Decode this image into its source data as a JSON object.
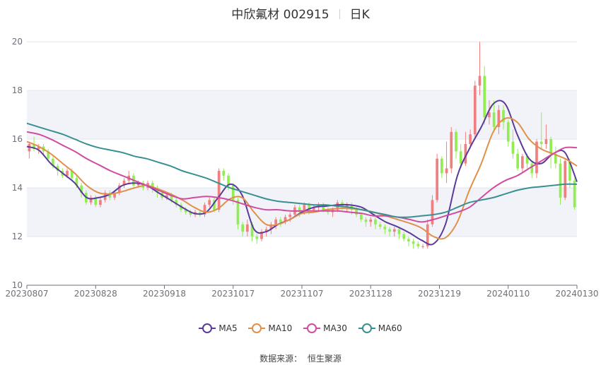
{
  "title": {
    "name": "中欣氟材 002915",
    "period": "日K"
  },
  "source": {
    "label": "数据来源：",
    "value": "恒生聚源"
  },
  "colors": {
    "up": "#f08080",
    "down": "#90ee50",
    "MA5": "#5a3a9a",
    "MA10": "#e0904a",
    "MA30": "#d04ca0",
    "MA60": "#3a9090",
    "band": "#f2f3f9",
    "grid": "#e3e5ee"
  },
  "chart_data": {
    "type": "candlestick",
    "x_range": [
      "20230807",
      "20240130"
    ],
    "xticks": [
      "20230807",
      "20230828",
      "20230918",
      "20231017",
      "20231107",
      "20231128",
      "20231219",
      "20240110",
      "20240130"
    ],
    "yticks": [
      10,
      12,
      14,
      16,
      18,
      20
    ],
    "ylim": [
      10,
      20.5
    ],
    "series": [
      {
        "name": "MA5",
        "values": [
          15.7,
          15.55,
          15.0,
          14.6,
          14.2,
          13.6,
          13.6,
          13.75,
          14.1,
          14.2,
          14.1,
          13.8,
          13.5,
          13.2,
          12.95,
          13.0,
          13.6,
          14.15,
          13.7,
          12.3,
          12.2,
          12.5,
          12.7,
          13.0,
          13.2,
          13.25,
          13.3,
          13.3,
          13.2,
          12.9,
          12.6,
          12.4,
          12.15,
          11.85,
          11.7,
          12.5,
          14.5,
          15.6,
          16.5,
          17.45,
          17.45,
          16.2,
          15.2,
          15.0,
          15.4,
          15.45,
          14.25
        ]
      },
      {
        "name": "MA10",
        "values": [
          15.9,
          15.7,
          15.4,
          15.0,
          14.6,
          14.1,
          13.8,
          13.75,
          13.85,
          14.0,
          14.1,
          13.95,
          13.75,
          13.5,
          13.2,
          13.0,
          13.15,
          13.55,
          13.6,
          13.0,
          12.5,
          12.5,
          12.7,
          12.95,
          13.0,
          13.1,
          13.15,
          13.15,
          13.1,
          13.0,
          12.85,
          12.7,
          12.55,
          12.35,
          12.0,
          11.95,
          12.6,
          13.9,
          15.0,
          16.3,
          16.85,
          16.7,
          16.0,
          15.6,
          15.4,
          15.2,
          14.9
        ]
      },
      {
        "name": "MA30",
        "values": [
          16.3,
          16.2,
          16.0,
          15.75,
          15.5,
          15.2,
          14.95,
          14.7,
          14.5,
          14.3,
          14.1,
          13.9,
          13.7,
          13.55,
          13.6,
          13.65,
          13.6,
          13.5,
          13.35,
          13.2,
          13.1,
          13.1,
          13.05,
          13.05,
          13.05,
          13.05,
          13.05,
          13.0,
          12.95,
          12.85,
          12.85,
          12.8,
          12.7,
          12.6,
          12.7,
          12.85,
          13.0,
          13.2,
          13.6,
          14.0,
          14.3,
          14.5,
          14.8,
          15.1,
          15.4,
          15.65,
          15.65
        ]
      },
      {
        "name": "MA60",
        "values": [
          16.65,
          16.5,
          16.35,
          16.2,
          16.0,
          15.8,
          15.65,
          15.55,
          15.45,
          15.3,
          15.2,
          15.05,
          14.9,
          14.7,
          14.55,
          14.4,
          14.2,
          14.0,
          13.85,
          13.7,
          13.55,
          13.45,
          13.4,
          13.35,
          13.3,
          13.3,
          13.25,
          13.2,
          13.1,
          13.0,
          12.9,
          12.8,
          12.8,
          12.85,
          12.9,
          13.0,
          13.2,
          13.4,
          13.5,
          13.6,
          13.75,
          13.9,
          14.0,
          14.05,
          14.1,
          14.15,
          14.15
        ]
      }
    ],
    "candles": [
      [
        15.5,
        15.8,
        15.9,
        15.2
      ],
      [
        15.8,
        15.6,
        16.1,
        15.5
      ],
      [
        15.6,
        15.7,
        15.8,
        15.4
      ],
      [
        15.7,
        15.5,
        15.8,
        15.3
      ],
      [
        15.5,
        15.2,
        15.6,
        15.1
      ],
      [
        15.2,
        14.9,
        15.3,
        14.8
      ],
      [
        14.9,
        14.7,
        15.0,
        14.5
      ],
      [
        14.7,
        14.5,
        14.8,
        14.4
      ],
      [
        14.5,
        14.7,
        14.8,
        14.4
      ],
      [
        14.7,
        14.4,
        14.8,
        14.3
      ],
      [
        14.4,
        14.1,
        14.5,
        14.0
      ],
      [
        14.1,
        13.8,
        14.2,
        13.6
      ],
      [
        13.8,
        13.4,
        13.9,
        13.3
      ],
      [
        13.4,
        13.6,
        13.7,
        13.3
      ],
      [
        13.6,
        13.3,
        13.7,
        13.2
      ],
      [
        13.3,
        13.5,
        13.6,
        13.2
      ],
      [
        13.5,
        13.8,
        13.9,
        13.4
      ],
      [
        13.8,
        13.6,
        13.9,
        13.5
      ],
      [
        13.6,
        13.8,
        13.9,
        13.5
      ],
      [
        13.8,
        14.1,
        14.2,
        13.7
      ],
      [
        14.1,
        14.3,
        14.4,
        14.0
      ],
      [
        14.3,
        14.5,
        14.7,
        14.2
      ],
      [
        14.5,
        14.1,
        14.6,
        14.0
      ],
      [
        14.1,
        14.2,
        14.3,
        14.0
      ],
      [
        14.2,
        14.0,
        14.3,
        13.9
      ],
      [
        14.0,
        14.2,
        14.3,
        13.9
      ],
      [
        14.2,
        14.0,
        14.3,
        13.8
      ],
      [
        14.0,
        13.8,
        14.1,
        13.6
      ],
      [
        13.8,
        13.6,
        13.9,
        13.5
      ],
      [
        13.6,
        13.7,
        13.8,
        13.5
      ],
      [
        13.7,
        13.5,
        13.8,
        13.4
      ],
      [
        13.5,
        13.3,
        13.6,
        13.2
      ],
      [
        13.3,
        13.1,
        13.4,
        13.0
      ],
      [
        13.1,
        13.0,
        13.2,
        12.9
      ],
      [
        13.0,
        12.9,
        13.1,
        12.8
      ],
      [
        12.9,
        13.0,
        13.1,
        12.8
      ],
      [
        13.0,
        12.9,
        13.1,
        12.8
      ],
      [
        12.9,
        13.3,
        13.4,
        12.8
      ],
      [
        13.3,
        13.5,
        13.6,
        13.2
      ],
      [
        13.5,
        13.1,
        13.6,
        13.0
      ],
      [
        13.1,
        14.7,
        14.8,
        13.0
      ],
      [
        14.7,
        14.5,
        14.8,
        14.3
      ],
      [
        14.5,
        14.1,
        14.6,
        13.9
      ],
      [
        14.1,
        13.5,
        14.2,
        13.3
      ],
      [
        13.5,
        12.5,
        13.6,
        12.3
      ],
      [
        12.5,
        12.2,
        12.6,
        12.0
      ],
      [
        12.2,
        12.5,
        12.7,
        12.0
      ],
      [
        12.5,
        12.0,
        12.6,
        11.8
      ],
      [
        12.0,
        11.9,
        12.1,
        11.7
      ],
      [
        11.9,
        12.2,
        12.3,
        11.8
      ],
      [
        12.2,
        12.3,
        12.4,
        12.0
      ],
      [
        12.3,
        12.5,
        12.6,
        12.1
      ],
      [
        12.5,
        12.7,
        12.8,
        12.3
      ],
      [
        12.7,
        12.6,
        12.8,
        12.4
      ],
      [
        12.6,
        12.8,
        12.9,
        12.5
      ],
      [
        12.8,
        12.9,
        13.0,
        12.6
      ],
      [
        12.9,
        13.2,
        13.3,
        12.8
      ],
      [
        13.2,
        13.0,
        13.3,
        12.8
      ],
      [
        13.0,
        13.3,
        13.4,
        12.9
      ],
      [
        13.3,
        13.1,
        13.4,
        12.9
      ],
      [
        13.1,
        13.2,
        13.3,
        13.0
      ],
      [
        13.2,
        13.3,
        13.4,
        13.0
      ],
      [
        13.3,
        13.1,
        13.4,
        13.0
      ],
      [
        13.1,
        13.0,
        13.2,
        12.9
      ],
      [
        13.0,
        13.1,
        13.2,
        12.8
      ],
      [
        13.1,
        13.4,
        13.5,
        13.0
      ],
      [
        13.4,
        13.2,
        13.5,
        13.1
      ],
      [
        13.2,
        13.3,
        13.4,
        13.0
      ],
      [
        13.3,
        13.1,
        13.4,
        12.9
      ],
      [
        13.1,
        12.9,
        13.2,
        12.8
      ],
      [
        12.9,
        12.7,
        13.0,
        12.6
      ],
      [
        12.7,
        12.6,
        12.8,
        12.4
      ],
      [
        12.6,
        12.7,
        12.8,
        12.4
      ],
      [
        12.7,
        12.5,
        12.8,
        12.3
      ],
      [
        12.5,
        12.4,
        12.6,
        12.3
      ],
      [
        12.4,
        12.3,
        12.5,
        12.1
      ],
      [
        12.3,
        12.2,
        12.4,
        12.0
      ],
      [
        12.2,
        12.3,
        12.4,
        12.0
      ],
      [
        12.3,
        12.1,
        12.4,
        11.9
      ],
      [
        12.1,
        11.9,
        12.2,
        11.8
      ],
      [
        11.9,
        11.8,
        12.0,
        11.6
      ],
      [
        11.8,
        11.7,
        11.9,
        11.5
      ],
      [
        11.7,
        11.6,
        11.8,
        11.5
      ],
      [
        11.6,
        11.6,
        11.7,
        11.5
      ],
      [
        11.6,
        12.5,
        12.7,
        11.5
      ],
      [
        12.5,
        13.5,
        13.7,
        12.4
      ],
      [
        13.5,
        15.2,
        15.4,
        13.4
      ],
      [
        15.2,
        14.6,
        15.3,
        14.4
      ],
      [
        14.6,
        14.8,
        15.9,
        14.2
      ],
      [
        14.8,
        16.3,
        16.5,
        14.6
      ],
      [
        16.3,
        15.5,
        16.4,
        15.2
      ],
      [
        15.5,
        15.0,
        15.8,
        14.8
      ],
      [
        15.0,
        15.8,
        16.3,
        14.9
      ],
      [
        15.8,
        16.2,
        16.4,
        15.6
      ],
      [
        16.2,
        18.2,
        18.4,
        16.0
      ],
      [
        18.2,
        18.6,
        20.0,
        17.8
      ],
      [
        18.6,
        16.9,
        19.0,
        16.6
      ],
      [
        16.9,
        17.1,
        17.6,
        16.6
      ],
      [
        17.1,
        16.5,
        17.6,
        16.3
      ],
      [
        16.5,
        17.2,
        17.4,
        16.2
      ],
      [
        17.2,
        16.7,
        17.4,
        16.4
      ],
      [
        16.7,
        15.9,
        16.8,
        15.7
      ],
      [
        15.9,
        15.4,
        16.4,
        15.2
      ],
      [
        15.4,
        14.8,
        15.6,
        14.7
      ],
      [
        14.8,
        15.3,
        15.4,
        14.6
      ],
      [
        15.3,
        15.0,
        15.4,
        14.8
      ],
      [
        15.0,
        14.6,
        15.1,
        14.4
      ],
      [
        14.6,
        15.9,
        16.0,
        14.4
      ],
      [
        15.9,
        15.8,
        17.1,
        15.6
      ],
      [
        15.8,
        16.0,
        16.6,
        15.6
      ],
      [
        16.0,
        15.4,
        16.1,
        14.8
      ],
      [
        15.4,
        15.0,
        15.7,
        14.8
      ],
      [
        15.0,
        13.6,
        15.2,
        13.3
      ],
      [
        13.6,
        15.1,
        15.2,
        13.5
      ],
      [
        15.1,
        14.3,
        15.2,
        14.0
      ],
      [
        14.3,
        13.2,
        14.4,
        13.1
      ]
    ]
  }
}
